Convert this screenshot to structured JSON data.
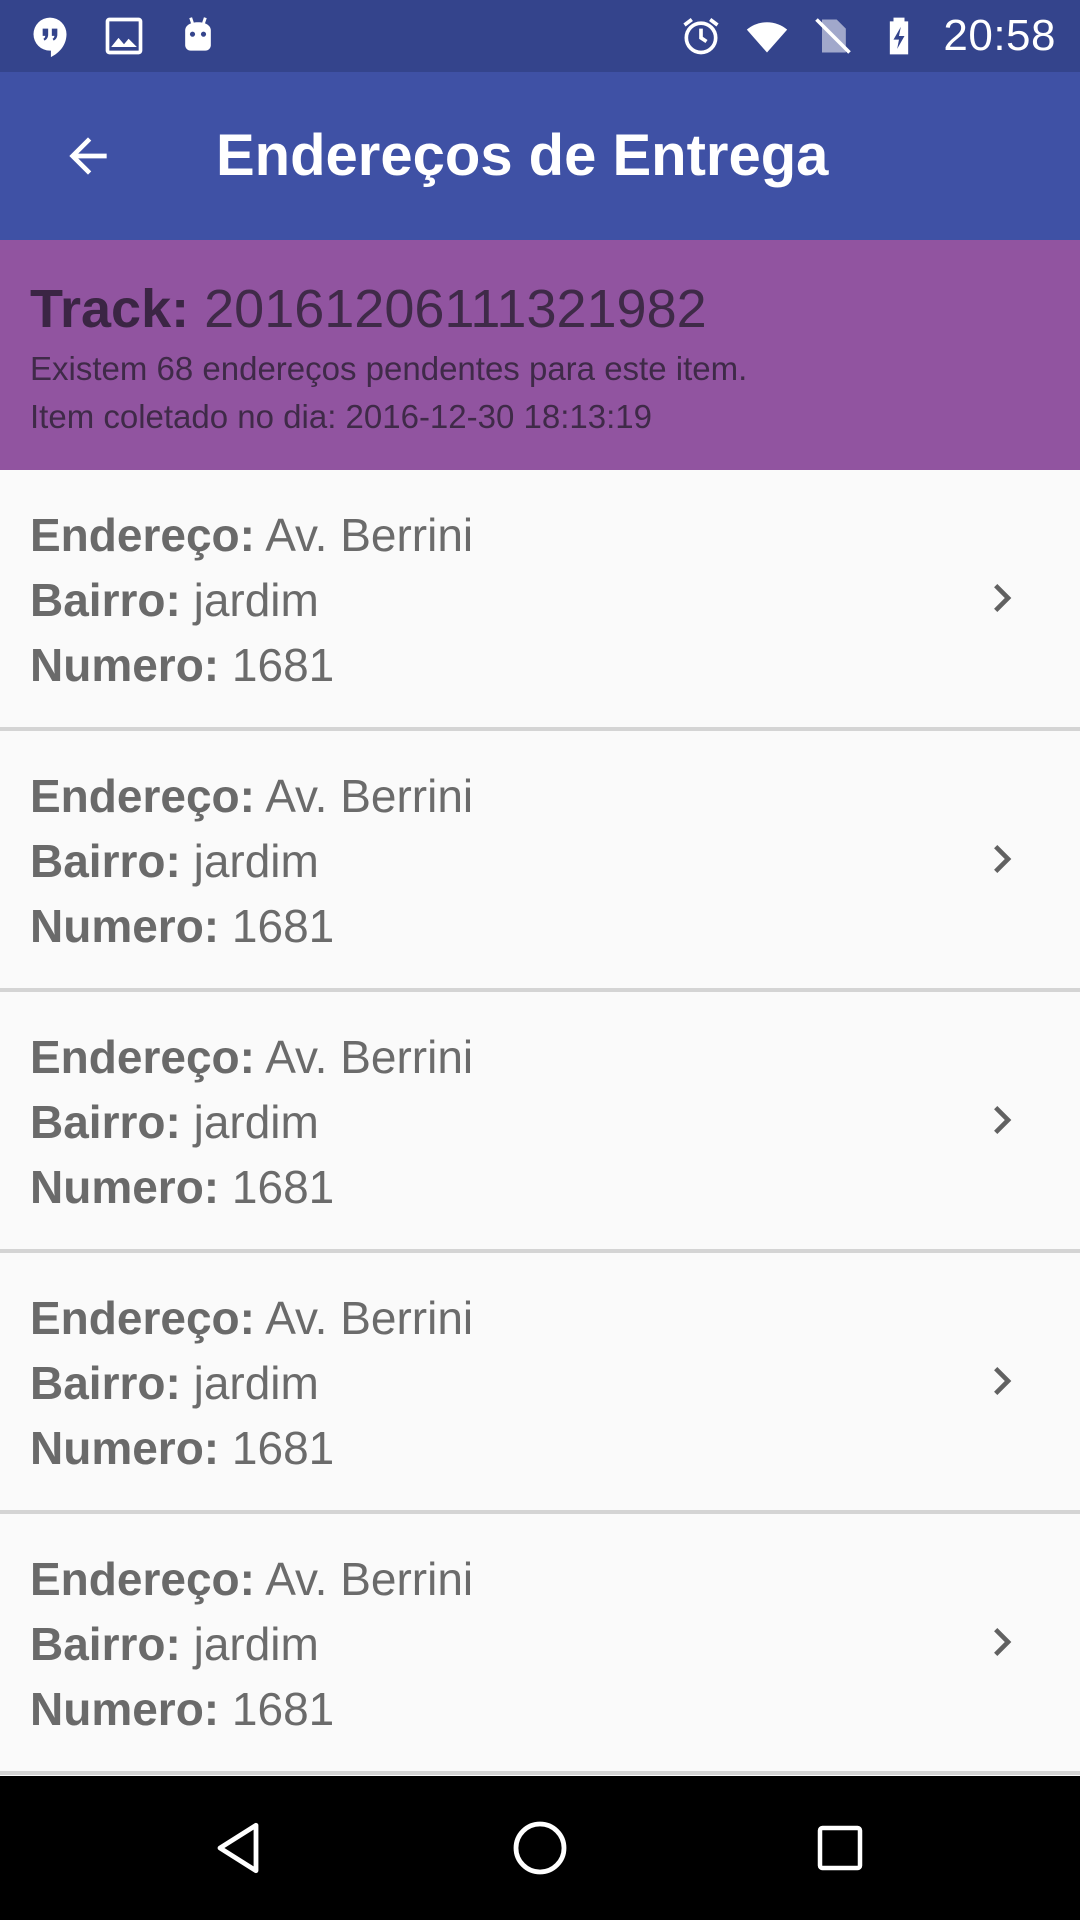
{
  "status_bar": {
    "time": "20:58",
    "left_icons": [
      "hangouts-icon",
      "image-icon",
      "android-icon"
    ],
    "right_icons": [
      "alarm-icon",
      "wifi-icon",
      "no-sim-icon",
      "battery-charging-icon"
    ]
  },
  "app_bar": {
    "title": "Endereços de Entrega",
    "back_icon": "arrow-back-icon",
    "color": "#3f51a5"
  },
  "track": {
    "label": "Track:",
    "code": "20161206111321982",
    "pending_text": "Existem 68 endereços pendentes para este item.",
    "collected_text": "Item coletado no dia: 2016-12-30 18:13:19",
    "color": "#9154a0"
  },
  "labels": {
    "endereco": "Endereço:",
    "bairro": "Bairro:",
    "numero": "Numero:"
  },
  "addresses": [
    {
      "endereco": "Av. Berrini",
      "bairro": "jardim",
      "numero": "1681"
    },
    {
      "endereco": "Av. Berrini",
      "bairro": "jardim",
      "numero": "1681"
    },
    {
      "endereco": "Av. Berrini",
      "bairro": "jardim",
      "numero": "1681"
    },
    {
      "endereco": "Av. Berrini",
      "bairro": "jardim",
      "numero": "1681"
    },
    {
      "endereco": "Av. Berrini",
      "bairro": "jardim",
      "numero": "1681"
    }
  ],
  "nav_bar": {
    "icons": [
      "nav-back-icon",
      "nav-home-icon",
      "nav-recents-icon"
    ]
  }
}
